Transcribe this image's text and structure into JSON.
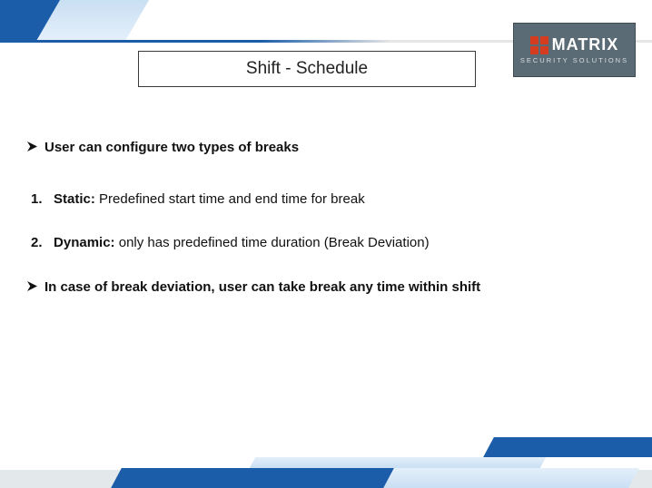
{
  "header": {
    "logo_text": "MATRIX",
    "logo_sub": "SECURITY SOLUTIONS"
  },
  "title": "Shift - Schedule",
  "bullets": {
    "b1": "User can configure two types of breaks",
    "b2": "In case of break deviation, user can take break any time within shift"
  },
  "items": {
    "n1_prefix": "1.",
    "n1_lead": "Static:",
    "n1_rest": " Predefined start time and end time for break",
    "n2_prefix": "2.",
    "n2_lead": "Dynamic:",
    "n2_rest": " only has predefined time duration (Break Deviation)"
  }
}
